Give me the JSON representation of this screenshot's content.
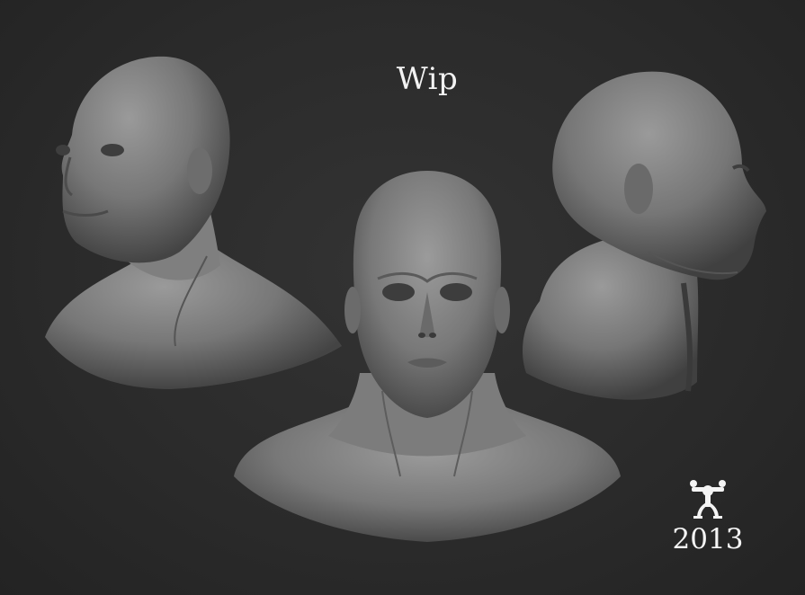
{
  "scene": {
    "title": "Wip",
    "signature": {
      "year": "2013",
      "symbol": "coqui-frog-glyph"
    },
    "colors": {
      "background": "#2c2c2c",
      "sculpt_base": "#7a7a7a",
      "sculpt_light": "#9a9a9a",
      "sculpt_shadow": "#3e3e3e",
      "text": "#f2f2f2"
    }
  }
}
